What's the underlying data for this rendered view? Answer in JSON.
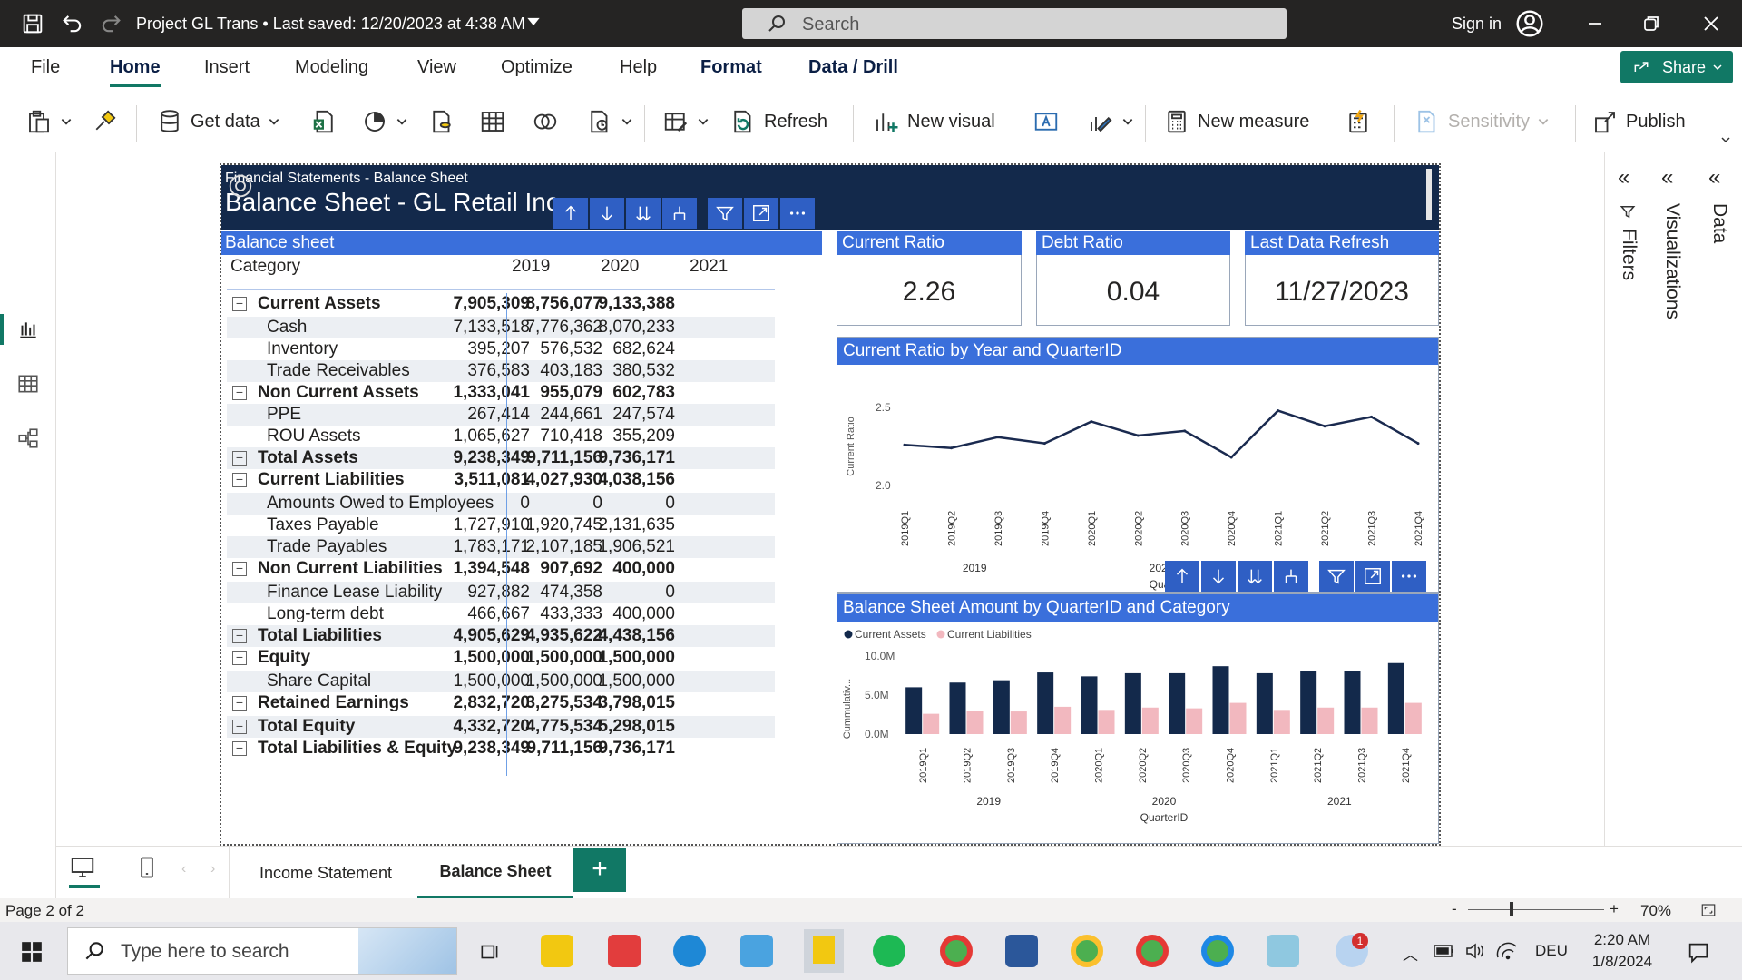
{
  "titlebar": {
    "title": "Project GL Trans • Last saved: 12/20/2023 at 4:38 AM",
    "search_placeholder": "Search",
    "signin": "Sign in"
  },
  "menu": {
    "items": [
      "File",
      "Home",
      "Insert",
      "Modeling",
      "View",
      "Optimize",
      "Help",
      "Format",
      "Data / Drill"
    ],
    "active": "Home",
    "share": "Share"
  },
  "toolbar": {
    "get_data": "Get data",
    "refresh": "Refresh",
    "new_visual": "New visual",
    "new_measure": "New measure",
    "sensitivity": "Sensitivity",
    "publish": "Publish"
  },
  "report": {
    "subtitle": "Financial Statements - Balance Sheet",
    "title": "Balance Sheet - GL Retail Inc",
    "matrix": {
      "title": "Balance sheet",
      "col_category": "Category",
      "years": [
        "2019",
        "2020",
        "2021"
      ],
      "rows": [
        {
          "label": "Current Assets",
          "type": "hdr",
          "v": [
            "7,905,309",
            "8,756,077",
            "9,133,388"
          ]
        },
        {
          "label": "Cash",
          "type": "child",
          "v": [
            "7,133,518",
            "7,776,362",
            "8,070,233"
          ]
        },
        {
          "label": "Inventory",
          "type": "child",
          "v": [
            "395,207",
            "576,532",
            "682,624"
          ]
        },
        {
          "label": "Trade Receivables",
          "type": "child",
          "v": [
            "376,583",
            "403,183",
            "380,532"
          ]
        },
        {
          "label": "Non Current Assets",
          "type": "hdr",
          "v": [
            "1,333,041",
            "955,079",
            "602,783"
          ]
        },
        {
          "label": "PPE",
          "type": "child",
          "v": [
            "267,414",
            "244,661",
            "247,574"
          ]
        },
        {
          "label": "ROU Assets",
          "type": "child",
          "v": [
            "1,065,627",
            "710,418",
            "355,209"
          ]
        },
        {
          "label": "Total Assets",
          "type": "hdr",
          "v": [
            "9,238,349",
            "9,711,156",
            "9,736,171"
          ]
        },
        {
          "label": "Current Liabilities",
          "type": "hdr",
          "v": [
            "3,511,081",
            "4,027,930",
            "4,038,156"
          ]
        },
        {
          "label": "Amounts Owed to Employees",
          "type": "child",
          "v": [
            "0",
            "0",
            "0"
          ]
        },
        {
          "label": "Taxes Payable",
          "type": "child",
          "v": [
            "1,727,910",
            "1,920,745",
            "2,131,635"
          ]
        },
        {
          "label": "Trade Payables",
          "type": "child",
          "v": [
            "1,783,171",
            "2,107,185",
            "1,906,521"
          ]
        },
        {
          "label": "Non Current Liabilities",
          "type": "hdr",
          "v": [
            "1,394,548",
            "907,692",
            "400,000"
          ]
        },
        {
          "label": "Finance Lease Liability",
          "type": "child",
          "v": [
            "927,882",
            "474,358",
            "0"
          ]
        },
        {
          "label": "Long-term debt",
          "type": "child",
          "v": [
            "466,667",
            "433,333",
            "400,000"
          ]
        },
        {
          "label": "Total Liabilities",
          "type": "hdr",
          "v": [
            "4,905,629",
            "4,935,622",
            "4,438,156"
          ]
        },
        {
          "label": "Equity",
          "type": "hdr",
          "v": [
            "1,500,000",
            "1,500,000",
            "1,500,000"
          ]
        },
        {
          "label": "Share Capital",
          "type": "child",
          "v": [
            "1,500,000",
            "1,500,000",
            "1,500,000"
          ]
        },
        {
          "label": "Retained Earnings",
          "type": "hdr",
          "v": [
            "2,832,720",
            "3,275,534",
            "3,798,015"
          ]
        },
        {
          "label": "Total Equity",
          "type": "hdr",
          "v": [
            "4,332,720",
            "4,775,534",
            "5,298,015"
          ]
        },
        {
          "label": "Total Liabilities & Equity",
          "type": "hdr",
          "v": [
            "9,238,349",
            "9,711,156",
            "9,736,171"
          ]
        }
      ]
    },
    "cards": [
      {
        "title": "Current Ratio",
        "value": "2.26"
      },
      {
        "title": "Debt Ratio",
        "value": "0.04"
      },
      {
        "title": "Last Data Refresh",
        "value": "11/27/2023"
      }
    ]
  },
  "chart_data": [
    {
      "type": "line",
      "title": "Current Ratio by Year and QuarterID",
      "ylabel": "Current Ratio",
      "xlabel": "QuarterID",
      "x": [
        "2019Q1",
        "2019Q2",
        "2019Q3",
        "2019Q4",
        "2020Q1",
        "2020Q2",
        "2020Q3",
        "2020Q4",
        "2021Q1",
        "2021Q2",
        "2021Q3",
        "2021Q4"
      ],
      "years": [
        "2019",
        "2020",
        "2021"
      ],
      "yticks": [
        "2.5",
        "2.0"
      ],
      "ylim": [
        1.9,
        2.6
      ],
      "series": [
        {
          "values": [
            2.26,
            2.24,
            2.31,
            2.27,
            2.41,
            2.32,
            2.35,
            2.18,
            2.48,
            2.38,
            2.44,
            2.27
          ]
        }
      ],
      "color": "#1a2a4f"
    },
    {
      "type": "bar",
      "title": "Balance Sheet Amount by QuarterID and Category",
      "ylabel": "Cummulativ...",
      "xlabel": "QuarterID",
      "categories": [
        "2019Q1",
        "2019Q2",
        "2019Q3",
        "2019Q4",
        "2020Q1",
        "2020Q2",
        "2020Q3",
        "2020Q4",
        "2021Q1",
        "2021Q2",
        "2021Q3",
        "2021Q4"
      ],
      "years": [
        "2019",
        "2020",
        "2021"
      ],
      "yticks": [
        "10.0M",
        "5.0M",
        "0.0M"
      ],
      "ylim": [
        0,
        10000000
      ],
      "series": [
        {
          "name": "Current Assets",
          "color": "#13294b",
          "values": [
            6000000,
            6600000,
            6900000,
            7900000,
            7400000,
            7800000,
            7800000,
            8700000,
            7800000,
            8100000,
            8100000,
            9100000
          ]
        },
        {
          "name": "Current Liabilities",
          "color": "#f2b8bf",
          "values": [
            2600000,
            3000000,
            2900000,
            3500000,
            3100000,
            3400000,
            3300000,
            4000000,
            3100000,
            3400000,
            3400000,
            4000000
          ]
        }
      ]
    }
  ],
  "panes": {
    "filters": "Filters",
    "visualizations": "Visualizations",
    "data": "Data"
  },
  "pages": {
    "tabs": [
      "Income Statement",
      "Balance Sheet"
    ],
    "active": "Balance Sheet",
    "add": "+"
  },
  "status": {
    "page": "Page 2 of 2",
    "zoom": "70%",
    "minus": "-",
    "plus": "+"
  },
  "taskbar": {
    "search_placeholder": "Type here to search",
    "lang": "DEU",
    "time": "2:20 AM",
    "date": "1/8/2024",
    "badge": "1"
  }
}
